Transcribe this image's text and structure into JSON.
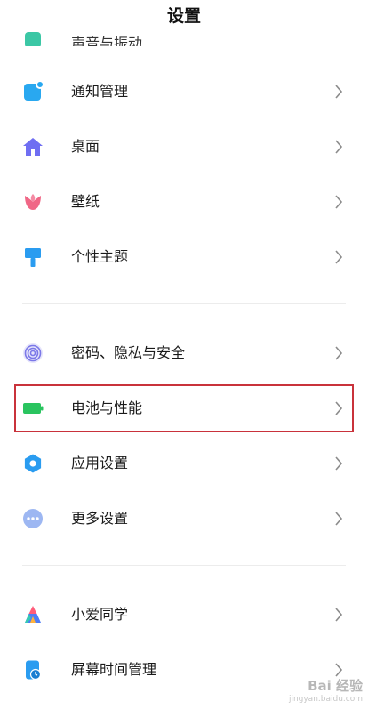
{
  "header": {
    "title": "设置"
  },
  "partial_item": {
    "label": "声音与振动",
    "icon": "sound-icon"
  },
  "groups": [
    {
      "items": [
        {
          "label": "通知管理",
          "icon": "notification-icon",
          "color": "#29a8f0"
        },
        {
          "label": "桌面",
          "icon": "home-icon",
          "color": "#6f6ef2"
        },
        {
          "label": "壁纸",
          "icon": "tulip-icon",
          "color": "#f06786"
        },
        {
          "label": "个性主题",
          "icon": "brush-icon",
          "color": "#2a9cf0"
        }
      ]
    },
    {
      "items": [
        {
          "label": "密码、隐私与安全",
          "icon": "fingerprint-icon",
          "color": "#7b78e8"
        },
        {
          "label": "电池与性能",
          "icon": "battery-icon",
          "color": "#2ac45f"
        },
        {
          "label": "应用设置",
          "icon": "gear-icon",
          "color": "#2a9cf0"
        },
        {
          "label": "更多设置",
          "icon": "more-icon",
          "color": "#7fa6f0"
        }
      ]
    },
    {
      "items": [
        {
          "label": "小爱同学",
          "icon": "xiaoai-icon",
          "color": "#4d7cf5"
        },
        {
          "label": "屏幕时间管理",
          "icon": "screen-time-icon",
          "color": "#2a9cf0"
        }
      ]
    }
  ],
  "highlight_color": "#c9323b",
  "watermark": {
    "main": "Bai 经验",
    "sub": "jingyan.baidu.com"
  }
}
